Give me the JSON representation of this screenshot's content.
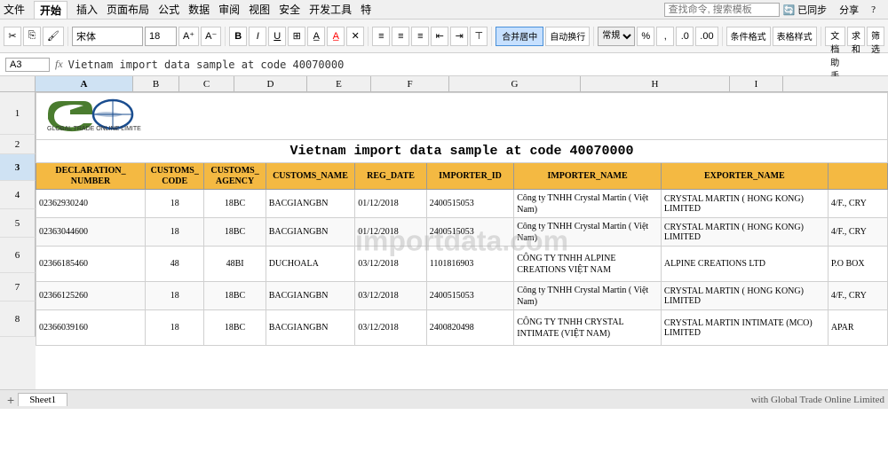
{
  "menubar": {
    "tabs": [
      "文件",
      "开始",
      "插入",
      "页面布局",
      "公式",
      "数据",
      "审阅",
      "视图",
      "安全",
      "开发工具",
      "特"
    ],
    "active_tab": "开始",
    "right_items": [
      "查找命令, 搜索模板",
      "已同步",
      "分享",
      "?"
    ],
    "search_placeholder": "查找命令, 搜索模板"
  },
  "formatting": {
    "font_name": "宋体",
    "font_size": "18",
    "bold": "B",
    "italic": "I",
    "underline": "U",
    "align_left": "≡",
    "align_center": "≡",
    "align_right": "≡",
    "merge_label": "合并居中",
    "wrap_label": "自动换行",
    "format_label": "条件格式",
    "table_format": "表格样式",
    "doc_help": "文档助手",
    "sum_label": "求和",
    "filter_label": "筛选"
  },
  "formula_bar": {
    "cell_ref": "A3",
    "fx": "fx",
    "formula": "Vietnam import data sample at code 40070000"
  },
  "spreadsheet": {
    "col_headers": [
      "A",
      "B",
      "C",
      "D",
      "E",
      "F",
      "G",
      "H",
      "I"
    ],
    "title": "Vietnam import data sample at code 40070000",
    "table_headers": [
      "DECLARATION_NUMBER",
      "CUSTOMS_CODE",
      "CUSTOMS_AGENCY",
      "CUSTOMS_NAME",
      "REG_DATE",
      "IMPORTER_ID",
      "IMPORTER_NAME",
      "EXPORTER_NAME",
      ""
    ],
    "rows": [
      {
        "declaration": "02362930240",
        "customs_code": "18",
        "customs_agency": "18BC",
        "customs_name": "BACGIANGBN",
        "reg_date": "01/12/2018",
        "importer_id": "2400515053",
        "importer_name": "Công ty TNHH Crystal Martin ( Việt Nam)",
        "exporter_name": "CRYSTAL MARTIN ( HONG KONG) LIMITED",
        "extra": "4/F., CRY"
      },
      {
        "declaration": "02363044600",
        "customs_code": "18",
        "customs_agency": "18BC",
        "customs_name": "BACGIANGBN",
        "reg_date": "01/12/2018",
        "importer_id": "2400515053",
        "importer_name": "Công ty TNHH Crystal Martin ( Việt Nam)",
        "exporter_name": "CRYSTAL MARTIN ( HONG KONG) LIMITED",
        "extra": "4/F., CRY"
      },
      {
        "declaration": "02366185460",
        "customs_code": "48",
        "customs_agency": "48BI",
        "customs_name": "DUCHOALA",
        "reg_date": "03/12/2018",
        "importer_id": "1101816903",
        "importer_name": "CÔNG TY TNHH ALPINE CREATIONS VIỆT NAM",
        "exporter_name": "ALPINE CREATIONS  LTD",
        "extra": "P.O BOX"
      },
      {
        "declaration": "02366125260",
        "customs_code": "18",
        "customs_agency": "18BC",
        "customs_name": "BACGIANGBN",
        "reg_date": "03/12/2018",
        "importer_id": "2400515053",
        "importer_name": "Công ty TNHH Crystal Martin ( Việt Nam)",
        "exporter_name": "CRYSTAL MARTIN ( HONG KONG) LIMITED",
        "extra": "4/F., CRY"
      },
      {
        "declaration": "02366039160",
        "customs_code": "18",
        "customs_agency": "18BC",
        "customs_name": "BACGIANGBN",
        "reg_date": "03/12/2018",
        "importer_id": "2400820498",
        "importer_name": "CÔNG TY TNHH CRYSTAL INTIMATE (VIỆT NAM)",
        "exporter_name": "CRYSTAL MARTIN INTIMATE (MCO) LIMITED",
        "extra": "APAR"
      }
    ]
  },
  "watermark": "importdata.com",
  "bottom_text": "with Global Trade Online Limited",
  "sheet_tabs": [
    "Sheet1"
  ],
  "active_sheet": "Sheet1",
  "logo": {
    "text": "GTO",
    "subtext": "GLOBAL TRADE ONLINE LIMITED",
    "color_green": "#4a7c2f",
    "color_blue": "#1a4d8f"
  }
}
